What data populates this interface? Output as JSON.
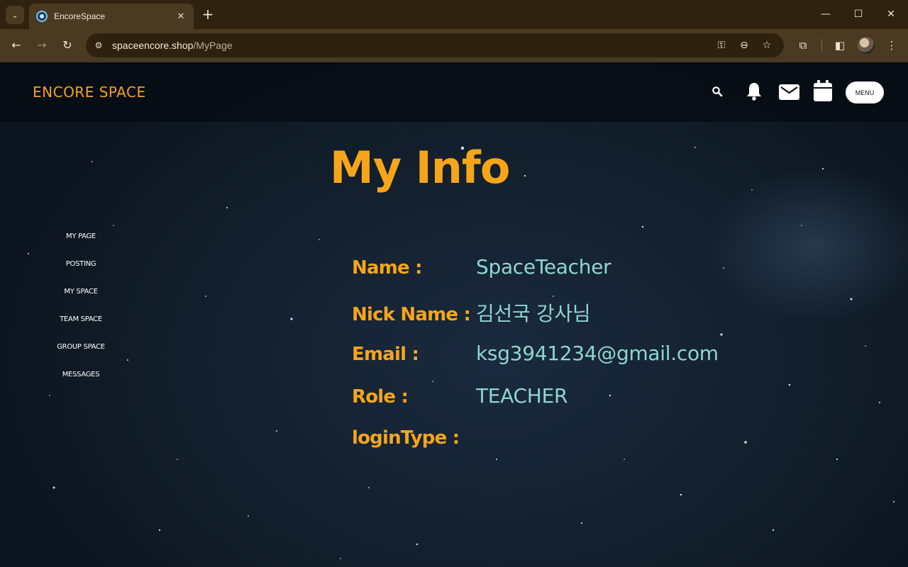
{
  "browser": {
    "tab_title": "EncoreSpace",
    "url_host": "spaceencore.shop",
    "url_path": "/MyPage"
  },
  "site": {
    "logo": "ENCORE SPACE",
    "menu_label": "MENU",
    "header_icons": [
      "search-icon",
      "bell-icon",
      "mail-icon",
      "calendar-icon"
    ]
  },
  "sidebar": {
    "items": [
      {
        "label": "MY PAGE"
      },
      {
        "label": "POSTING"
      },
      {
        "label": "MY SPACE"
      },
      {
        "label": "TEAM SPACE"
      },
      {
        "label": "GROUP SPACE"
      },
      {
        "label": "MESSAGES"
      }
    ]
  },
  "main": {
    "title": "My Info",
    "fields": [
      {
        "label": "Name :",
        "value": "SpaceTeacher"
      },
      {
        "label": "Nick Name :",
        "value": "김선국 강사님"
      },
      {
        "label": "Email :",
        "value": "ksg3941234@gmail.com"
      },
      {
        "label": "Role :",
        "value": "TEACHER"
      },
      {
        "label": "loginType :",
        "value": ""
      }
    ]
  },
  "colors": {
    "accent": "#f6a51a",
    "value_text": "#8fd6cf",
    "chrome_bg": "#4a3a22"
  }
}
